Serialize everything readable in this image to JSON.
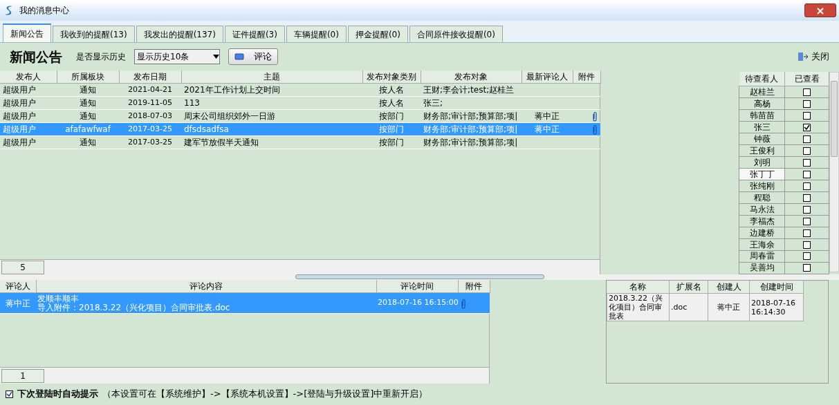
{
  "window": {
    "title": "我的消息中心"
  },
  "tabs": [
    {
      "label": "新闻公告",
      "selected": true
    },
    {
      "label": "我收到的提醒(13)",
      "selected": false
    },
    {
      "label": "我发出的提醒(137)",
      "selected": false
    },
    {
      "label": "证件提醒(3)",
      "selected": false
    },
    {
      "label": "车辆提醒(0)",
      "selected": false
    },
    {
      "label": "押金提醒(0)",
      "selected": false
    },
    {
      "label": "合同原件接收提醒(0)",
      "selected": false
    }
  ],
  "toolbar": {
    "heading": "新闻公告",
    "history_label": "是否显示历史",
    "history_select": "显示历史10条",
    "comment_button": "评论",
    "close_button": "关闭"
  },
  "news_table": {
    "columns": [
      "发布人",
      "所属板块",
      "发布日期",
      "主题",
      "发布对象类别",
      "发布对象",
      "最新评论人",
      "附件"
    ],
    "rows": [
      {
        "cells": [
          "超级用户",
          "通知",
          "2021-04-21",
          "2021年工作计划上交时间",
          "按人名",
          "王财;李会计;test;赵桂兰",
          ""
        ],
        "attachment": false,
        "selected": false
      },
      {
        "cells": [
          "超级用户",
          "通知",
          "2019-11-05",
          "113",
          "按人名",
          "张三;",
          ""
        ],
        "attachment": false,
        "selected": false
      },
      {
        "cells": [
          "超级用户",
          "通知",
          "2018-07-03",
          "周末公司组织郊外一日游",
          "按部门",
          "财务部;审计部;预算部;项|",
          "蒋中正"
        ],
        "attachment": true,
        "selected": false
      },
      {
        "cells": [
          "超级用户",
          "afafawfwaf",
          "2017-03-25",
          "dfsdsadfsa",
          "按部门",
          "财务部;审计部;预算部;项|",
          "蒋中正"
        ],
        "attachment": true,
        "selected": true
      },
      {
        "cells": [
          "超级用户",
          "通知",
          "2017-03-25",
          "建军节放假半天通知",
          "按部门",
          "财务部;审计部;预算部;项|",
          ""
        ],
        "attachment": false,
        "selected": false
      }
    ],
    "footer_count": "5"
  },
  "viewers": {
    "columns": [
      "待查看人",
      "已查看"
    ],
    "rows": [
      {
        "name": "赵桂兰",
        "checked": false,
        "selected": false
      },
      {
        "name": "高杨",
        "checked": false,
        "selected": false
      },
      {
        "name": "韩苗苗",
        "checked": false,
        "selected": false
      },
      {
        "name": "张三",
        "checked": true,
        "selected": false
      },
      {
        "name": "钟薇",
        "checked": false,
        "selected": false
      },
      {
        "name": "王俊利",
        "checked": false,
        "selected": false
      },
      {
        "name": "刘明",
        "checked": false,
        "selected": false
      },
      {
        "name": "张丁丁",
        "checked": false,
        "selected": true
      },
      {
        "name": "张纯刚",
        "checked": false,
        "selected": false
      },
      {
        "name": "程聪",
        "checked": false,
        "selected": false
      },
      {
        "name": "马永法",
        "checked": false,
        "selected": false
      },
      {
        "name": "李福杰",
        "checked": false,
        "selected": false
      },
      {
        "name": "边建桥",
        "checked": false,
        "selected": false
      },
      {
        "name": "王海余",
        "checked": false,
        "selected": false
      },
      {
        "name": "周春雷",
        "checked": false,
        "selected": false
      },
      {
        "name": "吴善均",
        "checked": false,
        "selected": false
      }
    ]
  },
  "comments": {
    "columns": [
      "评论人",
      "评论内容",
      "评论时间",
      "附件"
    ],
    "rows": [
      {
        "commenter": "蒋中正",
        "content": [
          "发顺丰顺丰",
          "导入附件：2018.3.22（兴化项目）合同审批表.doc"
        ],
        "time": "2018-07-16 16:15:00",
        "attachment": true,
        "selected": true
      }
    ],
    "footer_count": "1"
  },
  "attachments": {
    "columns": [
      "名称",
      "扩展名",
      "创建人",
      "创建时间"
    ],
    "rows": [
      {
        "cells": [
          "2018.3.22（兴化项目）合同审批表",
          ".doc",
          "蒋中正",
          "2018-07-16 16:14:30"
        ]
      }
    ]
  },
  "footer": {
    "auto_prompt": {
      "label": "下次登陆时自动提示",
      "checked": true
    },
    "note": "（本设置可在【系统维护】->【系统本机设置】->[登陆与升级设置]中重新开启）"
  }
}
